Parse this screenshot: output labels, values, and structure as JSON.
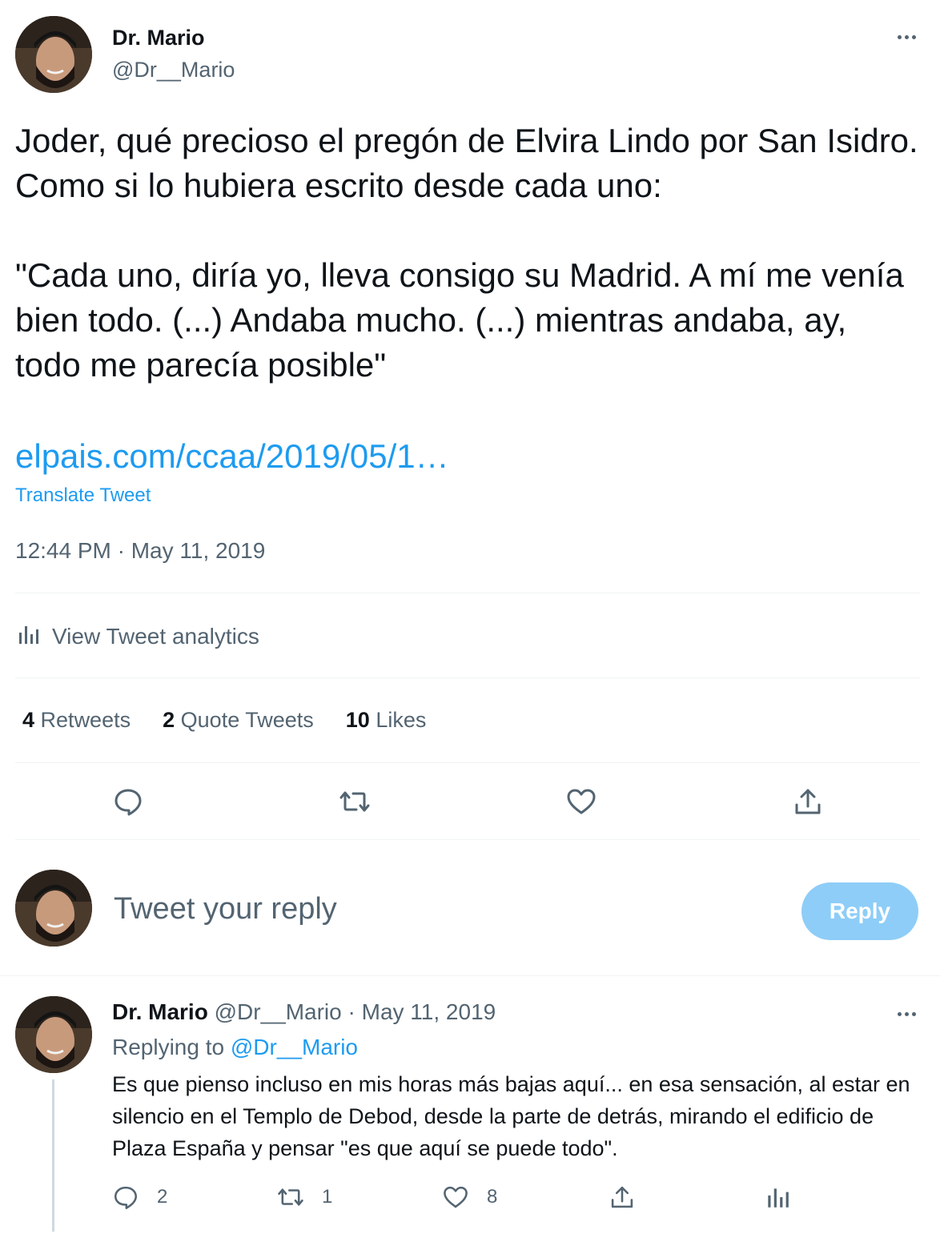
{
  "author": {
    "name": "Dr. Mario",
    "handle": "@Dr__Mario"
  },
  "tweet": {
    "text": "Joder, qué precioso el pregón de Elvira Lindo por San Isidro. Como si lo hubiera escrito desde cada uno:\n\n\"Cada uno, diría yo, lleva consigo su Madrid. A mí me venía bien todo. (...) Andaba mucho. (...) mientras andaba, ay, todo me parecía posible\"",
    "link": "elpais.com/ccaa/2019/05/1…",
    "translate_label": "Translate Tweet",
    "timestamp": "12:44 PM · May 11, 2019"
  },
  "analytics": {
    "label": "View Tweet analytics",
    "icon": "analytics-icon"
  },
  "stats": {
    "retweets_count": "4",
    "retweets_label": "Retweets",
    "quotes_count": "2",
    "quotes_label": "Quote Tweets",
    "likes_count": "10",
    "likes_label": "Likes"
  },
  "actions": [
    "reply-icon",
    "retweet-icon",
    "like-icon",
    "share-icon"
  ],
  "reply_box": {
    "placeholder": "Tweet your reply",
    "button_label": "Reply"
  },
  "reply_tweet": {
    "name": "Dr. Mario",
    "handle": "@Dr__Mario",
    "separator": "·",
    "date": "May 11, 2019",
    "replying_prefix": "Replying to",
    "replying_to": "@Dr__Mario",
    "text": "Es que pienso incluso en mis horas más bajas aquí... en esa sensación, al estar en silencio en el Templo de Debod, desde la parte de detrás, mirando el edificio de Plaza España y pensar \"es que aquí se puede todo\".",
    "reply_count": "2",
    "retweet_count": "1",
    "like_count": "8"
  },
  "colors": {
    "text_primary": "#0f1419",
    "text_secondary": "#536471",
    "link": "#1d9bf0",
    "reply_button_disabled": "#8ecdf8",
    "divider": "#eff3f4"
  }
}
